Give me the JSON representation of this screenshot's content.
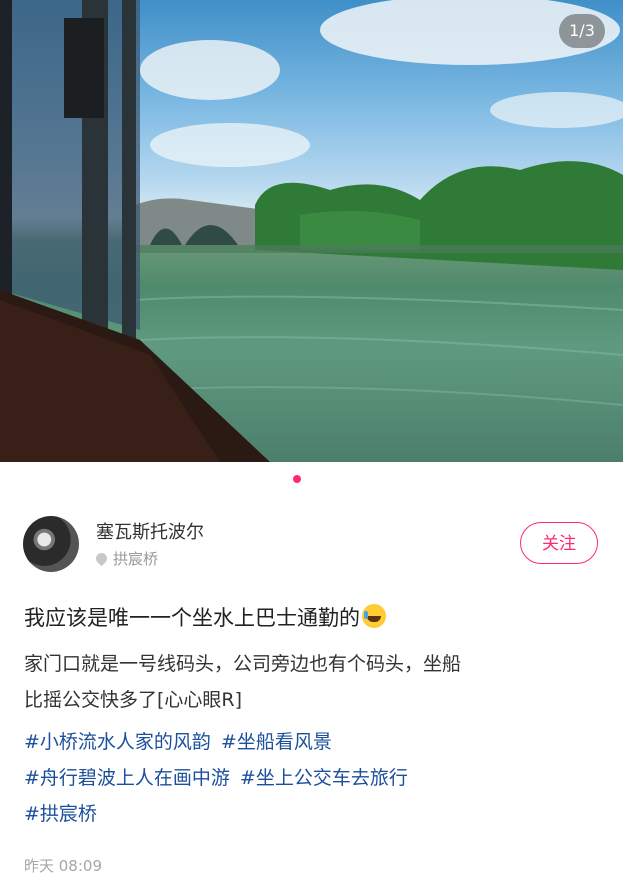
{
  "gallery": {
    "counter": "1/3",
    "current_index": 1,
    "total": 3
  },
  "post": {
    "author": {
      "name": "塞瓦斯托波尔",
      "location": "拱宸桥",
      "follow_label": "关注"
    },
    "title": "我应该是唯一一个坐水上巴士通勤的",
    "body_line1": "家门口就是一号线码头，公司旁边也有个码头，坐船",
    "body_line2": "比摇公交快多了[心心眼R]",
    "tags": [
      "#小桥流水人家的风韵",
      "#坐船看风景",
      "#舟行碧波上人在画中游",
      "#坐上公交车去旅行",
      "#拱宸桥"
    ],
    "timestamp": "昨天 08:09"
  },
  "colors": {
    "accent": "#ff2a6d",
    "tag": "#1c4f9c"
  },
  "icons": {
    "location": "location-pin-icon",
    "emoji": "laughing-tears-emoji"
  }
}
